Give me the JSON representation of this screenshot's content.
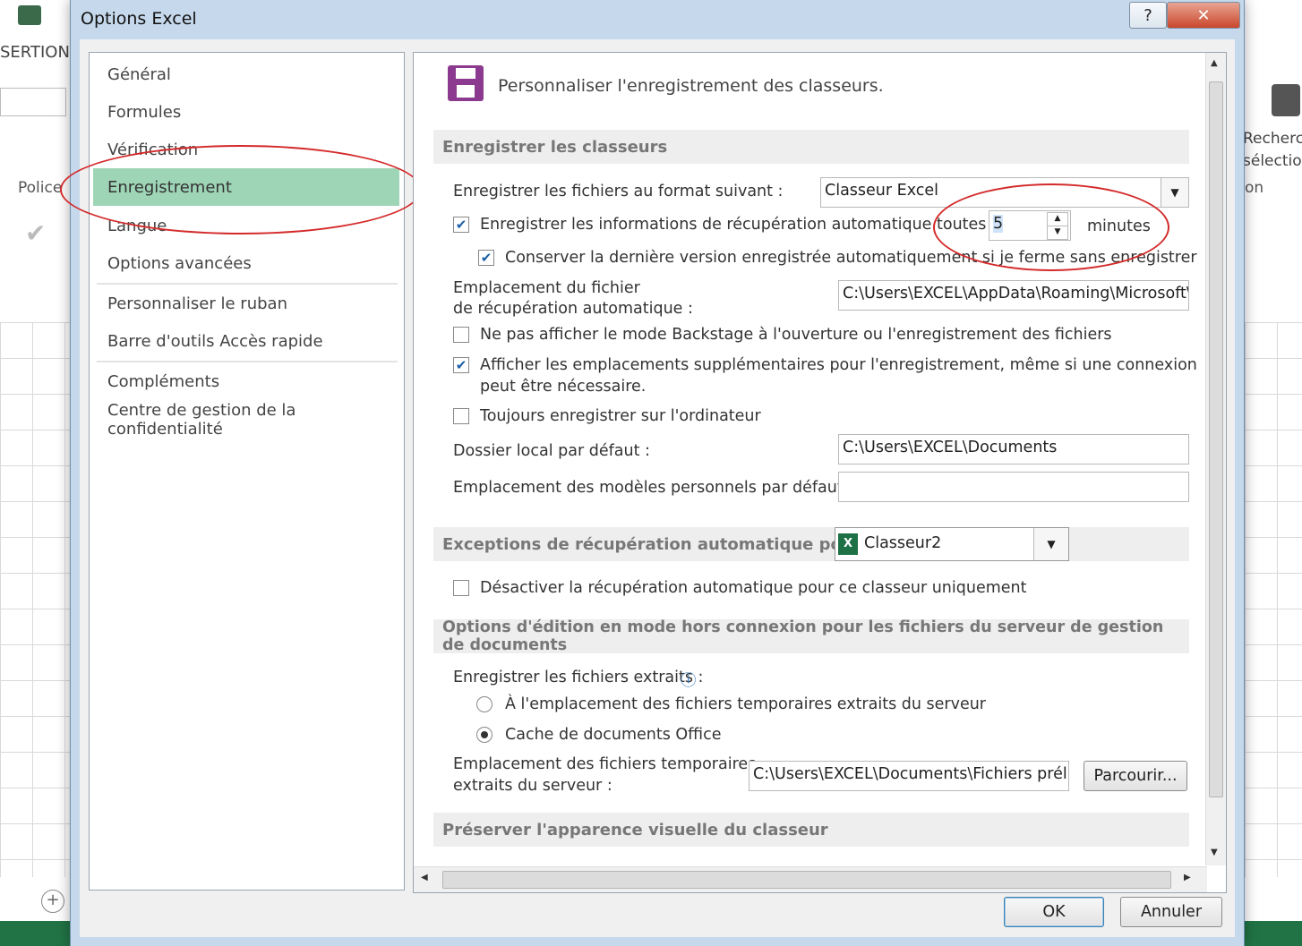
{
  "excel_background": {
    "ribbon_tab_partial": "SERTION",
    "group_police": "Police",
    "right_label_1": "Recherch",
    "right_label_2": "sélection",
    "right_label_3": "on"
  },
  "dialog": {
    "title": "Options Excel",
    "help_button": "?",
    "close_button": "✕"
  },
  "nav": {
    "items": [
      {
        "label": "Général"
      },
      {
        "label": "Formules"
      },
      {
        "label": "Vérification"
      },
      {
        "label": "Enregistrement"
      },
      {
        "label": "Langue"
      },
      {
        "label": "Options avancées"
      },
      {
        "label": "Personnaliser le ruban"
      },
      {
        "label": "Barre d'outils Accès rapide"
      },
      {
        "label": "Compléments"
      },
      {
        "label": "Centre de gestion de la confidentialité"
      }
    ],
    "active": "Enregistrement"
  },
  "content": {
    "header": "Personnaliser l'enregistrement des classeurs.",
    "section_save": {
      "title": "Enregistrer les classeurs",
      "format_label": "Enregistrer les fichiers au format suivant :",
      "format_value": "Classeur Excel",
      "autorecover_label": "Enregistrer les informations de récupération automatique toutes les",
      "autorecover_checked": true,
      "autorecover_minutes": "5",
      "minutes_label": "minutes",
      "keep_last_label": "Conserver la dernière version enregistrée automatiquement si je ferme sans enregistrer",
      "keep_last_checked": true,
      "autorecover_location_label_1": "Emplacement du fichier",
      "autorecover_location_label_2": "de récupération automatique :",
      "autorecover_location_value": "C:\\Users\\EXCEL\\AppData\\Roaming\\Microsoft\\",
      "no_backstage_label": "Ne pas afficher le mode Backstage à l'ouverture ou l'enregistrement des fichiers",
      "no_backstage_checked": false,
      "show_locations_label_1": "Afficher les emplacements supplémentaires pour l'enregistrement, même si une connexion",
      "show_locations_label_2": "peut être nécessaire.",
      "show_locations_checked": true,
      "always_local_label": "Toujours enregistrer sur l'ordinateur",
      "always_local_checked": false,
      "default_local_label": "Dossier local par défaut :",
      "default_local_value": "C:\\Users\\EXCEL\\Documents",
      "templates_label": "Emplacement des modèles personnels par défaut :",
      "templates_value": ""
    },
    "section_exceptions": {
      "title": "Exceptions de récupération automatique pour :",
      "workbook_value": "Classeur2",
      "disable_label": "Désactiver la récupération automatique pour ce classeur uniquement",
      "disable_checked": false
    },
    "section_offline": {
      "title": "Options d'édition en mode hors connexion pour les fichiers du serveur de gestion de documents",
      "save_checked_out_label": "Enregistrer les fichiers extraits :",
      "info_icon": "ⓘ",
      "radio_server_label": "À l'emplacement des fichiers temporaires extraits du serveur",
      "radio_cache_label": "Cache de documents Office",
      "selected_radio": "cache",
      "temp_location_label_1": "Emplacement des fichiers temporaires",
      "temp_location_label_2": "extraits du serveur :",
      "temp_location_value": "C:\\Users\\EXCEL\\Documents\\Fichiers prélir",
      "browse_button": "Parcourir..."
    },
    "section_visual": {
      "title": "Préserver l'apparence visuelle du classeur"
    }
  },
  "footer": {
    "ok_button": "OK",
    "cancel_button": "Annuler"
  },
  "colors": {
    "active_nav": "#9fd5b7",
    "annotation_red": "#d42a2a",
    "excel_green": "#217346",
    "save_icon_purple": "#8b3a8f"
  }
}
